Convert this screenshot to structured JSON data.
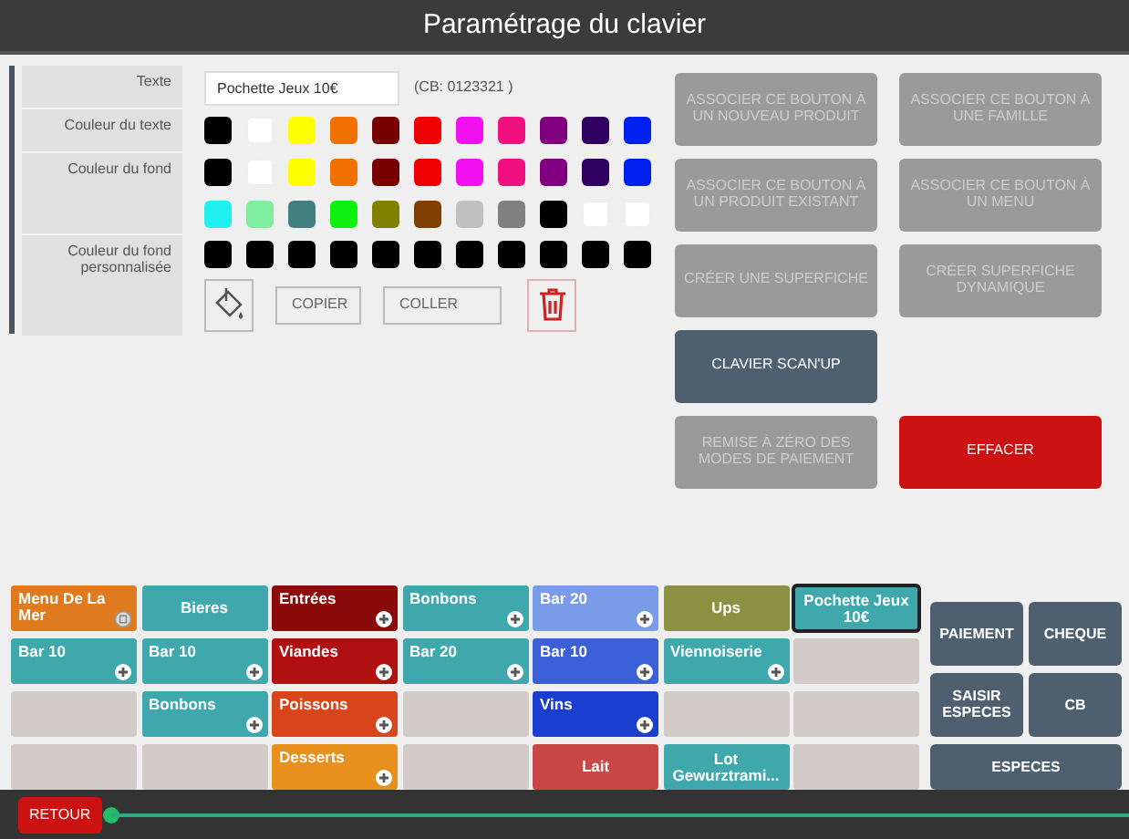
{
  "window": {
    "title": "Paramétrage du clavier"
  },
  "settings": {
    "text_label": "Texte",
    "text_value": "Pochette Jeux 10€",
    "barcode": "(CB: 0123321 )",
    "text_color_label": "Couleur du texte",
    "text_colors": [
      {
        "color": "#000000"
      },
      {
        "color": "#ffffff"
      },
      {
        "color": "#ffff00"
      },
      {
        "color": "#f07000"
      },
      {
        "color": "#780000"
      },
      {
        "color": "#f00000"
      },
      {
        "color": "#f010f0"
      },
      {
        "color": "#f01080"
      },
      {
        "color": "#800080"
      },
      {
        "color": "#300060"
      },
      {
        "color": "#0020f0"
      }
    ],
    "bg_color_label": "Couleur du fond",
    "bg_colors": [
      {
        "color": "#000000"
      },
      {
        "color": "#ffffff"
      },
      {
        "color": "#ffff00"
      },
      {
        "color": "#f07000"
      },
      {
        "color": "#780000"
      },
      {
        "color": "#f00000"
      },
      {
        "color": "#f010f0"
      },
      {
        "color": "#f01080"
      },
      {
        "color": "#800080"
      },
      {
        "color": "#300060"
      },
      {
        "color": "#0020f0"
      },
      {
        "color": "#20f0f0"
      },
      {
        "color": "#80f0a0"
      },
      {
        "color": "#408080"
      },
      {
        "color": "#10f010"
      },
      {
        "color": "#808000"
      },
      {
        "color": "#804000"
      },
      {
        "color": "#c0c0c0"
      },
      {
        "color": "#808080"
      },
      {
        "color": "#000000"
      },
      {
        "color": "#ffffff"
      },
      {
        "color": "#ffffff"
      }
    ],
    "custom_label": "Couleur du fond personnalisée",
    "custom_colors": [
      {
        "color": "#000000"
      },
      {
        "color": "#000000"
      },
      {
        "color": "#000000"
      },
      {
        "color": "#000000"
      },
      {
        "color": "#000000"
      },
      {
        "color": "#000000"
      },
      {
        "color": "#000000"
      },
      {
        "color": "#000000"
      },
      {
        "color": "#000000"
      },
      {
        "color": "#000000"
      },
      {
        "color": "#000000"
      }
    ],
    "copy_button": "COPIER",
    "paste_button": "COLLER"
  },
  "action_rows": [
    [
      {
        "label": "ASSOCIER CE BOUTON À UN NOUVEAU PRODUIT",
        "kind": "normal",
        "disabled": true
      },
      {
        "label": "ASSOCIER CE BOUTON À UNE FAMILLE",
        "kind": "normal",
        "disabled": true
      }
    ],
    [
      {
        "label": "ASSOCIER CE BOUTON À UN PRODUIT EXISTANT",
        "kind": "normal",
        "disabled": true
      },
      {
        "label": "ASSOCIER CE BOUTON À UN MENU",
        "kind": "normal",
        "disabled": true
      }
    ],
    [
      {
        "label": "CRÉER UNE SUPERFICHE",
        "kind": "normal",
        "disabled": true
      },
      {
        "label": "CRÉER SUPERFICHE DYNAMIQUE",
        "kind": "normal",
        "disabled": true
      }
    ],
    [
      {
        "label": "CLAVIER SCAN'UP",
        "kind": "normal",
        "disabled": false
      }
    ],
    [
      {
        "label": "REMISE À ZÉRO DES MODES DE PAIEMENT",
        "kind": "normal",
        "disabled": true
      },
      {
        "label": "EFFACER",
        "kind": "danger",
        "disabled": false
      }
    ]
  ],
  "keyboard": [
    [
      {
        "kind": "menu",
        "label": "Menu De La Mer",
        "color": "#e07a1e",
        "selected": false
      },
      {
        "kind": "key",
        "label": "Bieres",
        "color": "#3fa8ad",
        "selected": false
      },
      {
        "kind": "plus",
        "label": "Entrées",
        "color": "#8b0b0b",
        "selected": false
      },
      {
        "kind": "plus",
        "label": "Bonbons",
        "color": "#3fa8ad",
        "selected": false
      },
      {
        "kind": "plus",
        "label": "Bar 20",
        "color": "#7a9be8",
        "selected": false
      },
      {
        "kind": "key",
        "label": "Ups",
        "color": "#8a9140",
        "selected": false
      },
      {
        "kind": "key",
        "label": "Pochette Jeux 10€",
        "color": "#3fa8ad",
        "selected": true
      }
    ],
    [
      {
        "kind": "plus",
        "label": "Bar 10",
        "color": "#3fa8ad",
        "selected": false
      },
      {
        "kind": "plus",
        "label": "Bar 10",
        "color": "#3fa8ad",
        "selected": false
      },
      {
        "kind": "plus",
        "label": "Viandes",
        "color": "#b01010",
        "selected": false
      },
      {
        "kind": "plus",
        "label": "Bar 20",
        "color": "#3fa8ad",
        "selected": false
      },
      {
        "kind": "plus",
        "label": "Bar 10",
        "color": "#3a5fd6",
        "selected": false
      },
      {
        "kind": "plus",
        "label": "Viennoiserie",
        "color": "#3fa8ad",
        "selected": false
      },
      {
        "kind": "empty"
      }
    ],
    [
      {
        "kind": "empty"
      },
      {
        "kind": "plus",
        "label": "Bonbons",
        "color": "#3fa8ad",
        "selected": false
      },
      {
        "kind": "plus",
        "label": "Poissons",
        "color": "#d9451a",
        "selected": false
      },
      {
        "kind": "empty"
      },
      {
        "kind": "plus",
        "label": "Vins",
        "color": "#1a3fd0",
        "selected": false
      },
      {
        "kind": "empty"
      },
      {
        "kind": "empty"
      }
    ],
    [
      {
        "kind": "empty"
      },
      {
        "kind": "empty"
      },
      {
        "kind": "plus",
        "label": "Desserts",
        "color": "#e8901e",
        "selected": false
      },
      {
        "kind": "empty"
      },
      {
        "kind": "key",
        "label": "Lait",
        "color": "#c84848",
        "selected": false
      },
      {
        "kind": "key",
        "label": "Lot Gewurztrami...",
        "color": "#3fa8ad",
        "selected": false
      },
      {
        "kind": "empty"
      }
    ]
  ],
  "payment_rows": [
    [
      "PAIEMENT",
      "CHEQUE"
    ],
    [
      "SAISIR ESPECES",
      "CB"
    ],
    [
      "ESPECES"
    ]
  ],
  "footer": {
    "back_button": "RETOUR"
  }
}
